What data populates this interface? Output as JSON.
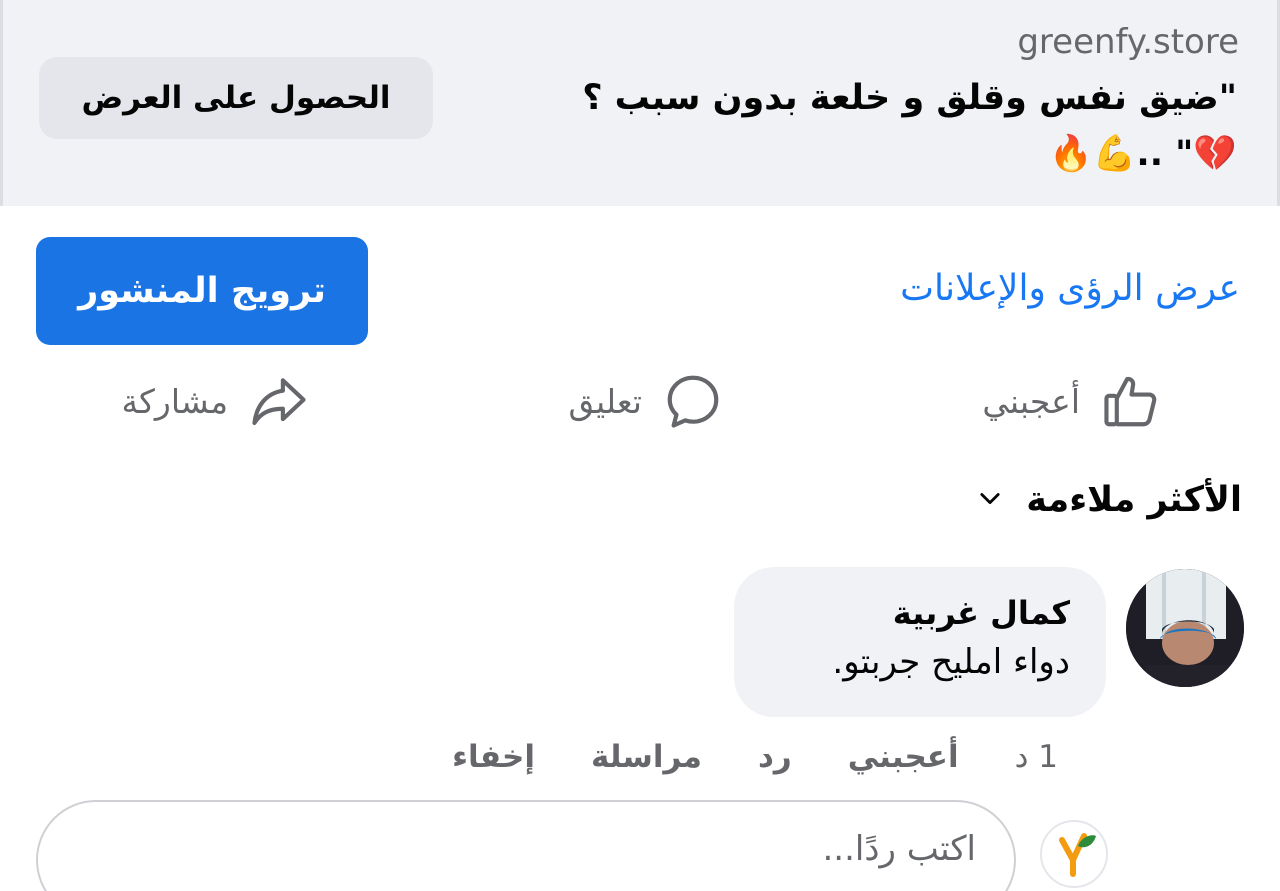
{
  "ad": {
    "domain": "greenfy.store",
    "headline": "\"ضيق نفس وقلق و خلعة بدون سبب ؟ 💔\" ..💪🔥",
    "cta_label": "الحصول على العرض"
  },
  "insights": {
    "link_label": "عرض الرؤى والإعلانات",
    "boost_label": "ترويج المنشور"
  },
  "actions": {
    "like_label": "أعجبني",
    "comment_label": "تعليق",
    "share_label": "مشاركة"
  },
  "sort": {
    "label": "الأكثر ملاءمة"
  },
  "comment": {
    "author": "كمال غربية",
    "text": "دواء امليح جربتو.",
    "time": "1 د",
    "like_label": "أعجبني",
    "reply_label": "رد",
    "message_label": "مراسلة",
    "hide_label": "إخفاء"
  },
  "reply_box": {
    "placeholder": "اكتب ردًا..."
  },
  "colors": {
    "accent": "#1877f2",
    "boost_button": "#1b74e4",
    "muted_text": "#65676b",
    "bubble_bg": "#f0f2f5"
  }
}
